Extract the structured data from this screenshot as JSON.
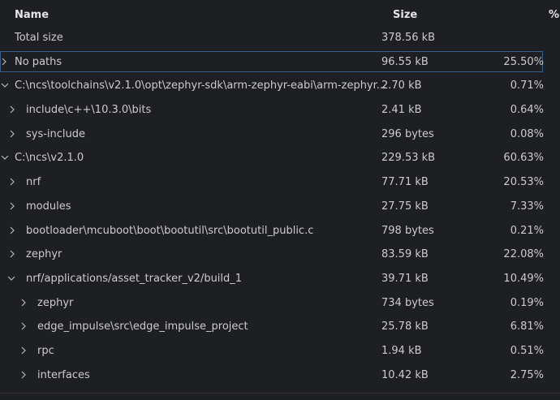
{
  "header": {
    "name_label": "Name",
    "size_label": "Size",
    "pct_label": "%"
  },
  "rows": [
    {
      "name": "Total size",
      "size": "378.56 kB",
      "pct": ""
    },
    {
      "name": "No paths",
      "size": "96.55 kB",
      "pct": "25.50%"
    },
    {
      "name": "C:\\ncs\\toolchains\\v2.1.0\\opt\\zephyr-sdk\\arm-zephyr-eabi\\arm-zephyr...",
      "size": "2.70 kB",
      "pct": "0.71%"
    },
    {
      "name": "include\\c++\\10.3.0\\bits",
      "size": "2.41 kB",
      "pct": "0.64%"
    },
    {
      "name": "sys-include",
      "size": "296 bytes",
      "pct": "0.08%"
    },
    {
      "name": "C:\\ncs\\v2.1.0",
      "size": "229.53 kB",
      "pct": "60.63%"
    },
    {
      "name": "nrf",
      "size": "77.71 kB",
      "pct": "20.53%"
    },
    {
      "name": "modules",
      "size": "27.75 kB",
      "pct": "7.33%"
    },
    {
      "name": "bootloader\\mcuboot\\boot\\bootutil\\src\\bootutil_public.c",
      "size": "798 bytes",
      "pct": "0.21%"
    },
    {
      "name": "zephyr",
      "size": "83.59 kB",
      "pct": "22.08%"
    },
    {
      "name": "nrf/applications/asset_tracker_v2/build_1",
      "size": "39.71 kB",
      "pct": "10.49%"
    },
    {
      "name": "zephyr",
      "size": "734 bytes",
      "pct": "0.19%"
    },
    {
      "name": "edge_impulse\\src\\edge_impulse_project",
      "size": "25.78 kB",
      "pct": "6.81%"
    },
    {
      "name": "rpc",
      "size": "1.94 kB",
      "pct": "0.51%"
    },
    {
      "name": "interfaces",
      "size": "10.42 kB",
      "pct": "2.75%"
    }
  ]
}
